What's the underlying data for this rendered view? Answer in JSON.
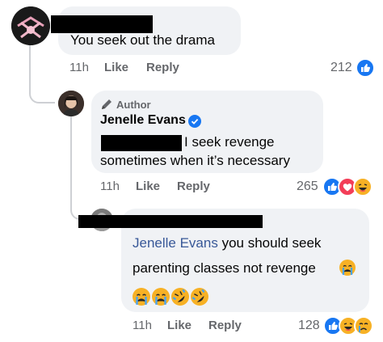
{
  "colors": {
    "bubble": "#f0f2f5",
    "meta": "#65676b",
    "like_blue": "#1877f2",
    "love_red": "#f33e58",
    "emoji_yellow": "#f7b125",
    "mention": "#385898"
  },
  "comment1": {
    "text": "You seek out the drama",
    "time": "11h",
    "like_label": "Like",
    "reply_label": "Reply",
    "reaction_count": "212",
    "reactions": [
      "like-icon"
    ]
  },
  "reply1": {
    "badge_label": "Author",
    "author": "Jenelle Evans",
    "text_line1": "I seek revenge",
    "text_line2": "sometimes when it’s necessary",
    "time": "11h",
    "like_label": "Like",
    "reply_label": "Reply",
    "reaction_count": "265",
    "reactions": [
      "like-icon",
      "love-icon",
      "haha-icon"
    ]
  },
  "reply2": {
    "mention": "Jenelle Evans",
    "text_line1_rest": " you should seek",
    "text_line2": "parenting classes not revenge",
    "emoji_row": [
      "crying-face-icon",
      "crying-face-icon",
      "rolling-laughing-icon",
      "rolling-laughing-icon"
    ],
    "time": "11h",
    "like_label": "Like",
    "reply_label": "Reply",
    "reaction_count": "128",
    "reactions": [
      "like-icon",
      "haha-icon",
      "sad-icon"
    ]
  }
}
